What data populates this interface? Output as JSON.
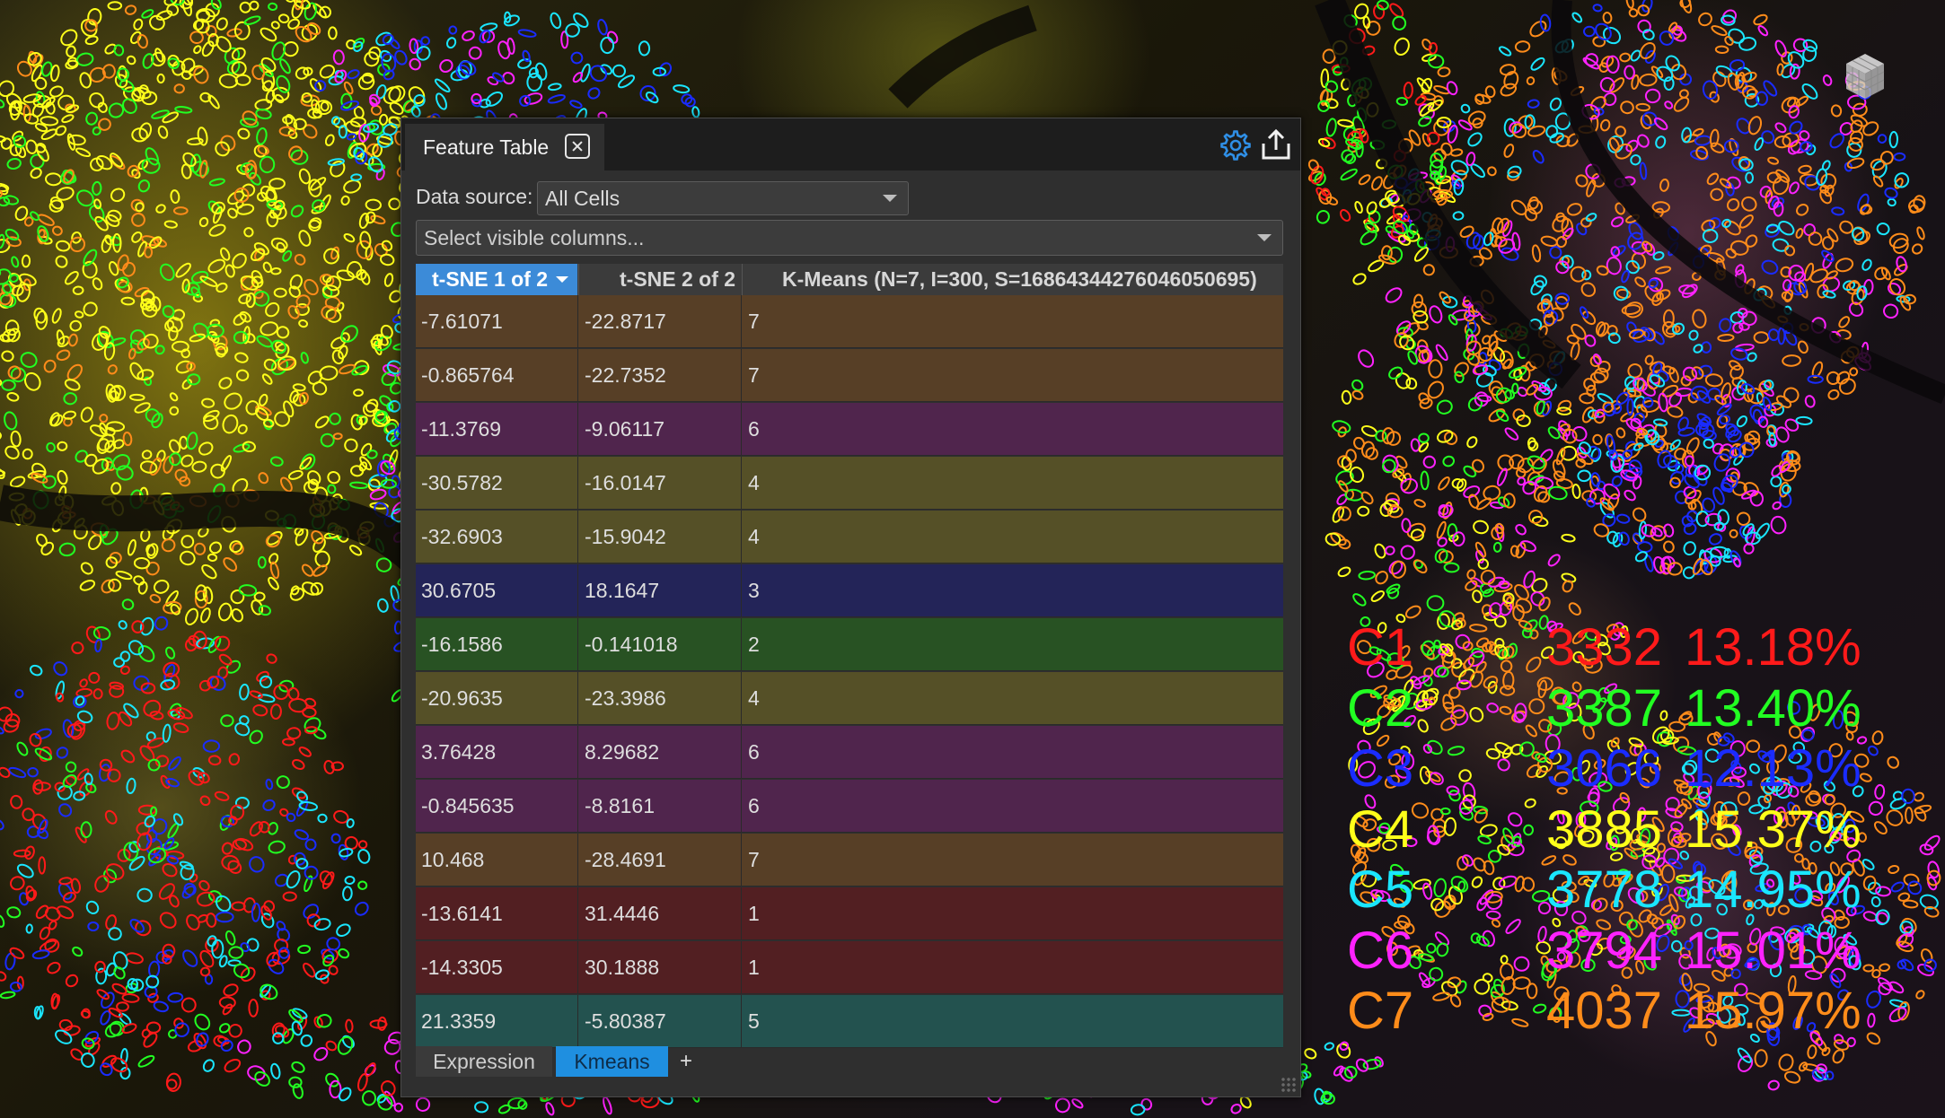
{
  "panel": {
    "title": "Feature Table",
    "data_source_label": "Data source:",
    "data_source_value": "All Cells",
    "columns_placeholder": "Select visible columns...",
    "icons": [
      "close-icon",
      "gear-icon",
      "export-icon",
      "resize-grip-icon"
    ]
  },
  "table": {
    "headers": [
      "t-SNE 1 of 2",
      "t-SNE 2 of 2",
      "K-Means (N=7, I=300, S=16864344276046050695)"
    ],
    "sorted_column": "t-SNE 1 of 2",
    "rows": [
      {
        "tsne1": "-7.61071",
        "tsne2": "-22.8717",
        "cluster": "7"
      },
      {
        "tsne1": "-0.865764",
        "tsne2": "-22.7352",
        "cluster": "7"
      },
      {
        "tsne1": "-11.3769",
        "tsne2": "-9.06117",
        "cluster": "6"
      },
      {
        "tsne1": "-30.5782",
        "tsne2": "-16.0147",
        "cluster": "4"
      },
      {
        "tsne1": "-32.6903",
        "tsne2": "-15.9042",
        "cluster": "4"
      },
      {
        "tsne1": "30.6705",
        "tsne2": "18.1647",
        "cluster": "3"
      },
      {
        "tsne1": "-16.1586",
        "tsne2": "-0.141018",
        "cluster": "2"
      },
      {
        "tsne1": "-20.9635",
        "tsne2": "-23.3986",
        "cluster": "4"
      },
      {
        "tsne1": "3.76428",
        "tsne2": "8.29682",
        "cluster": "6"
      },
      {
        "tsne1": "-0.845635",
        "tsne2": "-8.8161",
        "cluster": "6"
      },
      {
        "tsne1": "10.468",
        "tsne2": "-28.4691",
        "cluster": "7"
      },
      {
        "tsne1": "-13.6141",
        "tsne2": "31.4446",
        "cluster": "1"
      },
      {
        "tsne1": "-14.3305",
        "tsne2": "30.1888",
        "cluster": "1"
      },
      {
        "tsne1": "21.3359",
        "tsne2": "-5.80387",
        "cluster": "5"
      }
    ],
    "row_colors": {
      "1": "#521f22",
      "2": "#285223",
      "3": "#232458",
      "4": "#555027",
      "5": "#23524f",
      "6": "#50254d",
      "7": "#573f26"
    }
  },
  "bottom_tabs": {
    "tabs": [
      "Expression",
      "Kmeans"
    ],
    "active": "Kmeans",
    "add_label": "+"
  },
  "legend": {
    "clusters": [
      {
        "id": "C1",
        "count": "3332",
        "percent": "13.18%",
        "color": "#ff1a1a"
      },
      {
        "id": "C2",
        "count": "3387",
        "percent": "13.40%",
        "color": "#22ff22"
      },
      {
        "id": "C3",
        "count": "3066",
        "percent": "12.13%",
        "color": "#1a2cff"
      },
      {
        "id": "C4",
        "count": "3885",
        "percent": "15.37%",
        "color": "#ffff1a"
      },
      {
        "id": "C5",
        "count": "3778",
        "percent": "14.95%",
        "color": "#1ae6ff"
      },
      {
        "id": "C6",
        "count": "3794",
        "percent": "15.01%",
        "color": "#ff22ff"
      },
      {
        "id": "C7",
        "count": "4037",
        "percent": "15.97%",
        "color": "#ff8c1a"
      }
    ]
  },
  "viewer": {
    "icons": [
      "cube-icon"
    ]
  }
}
